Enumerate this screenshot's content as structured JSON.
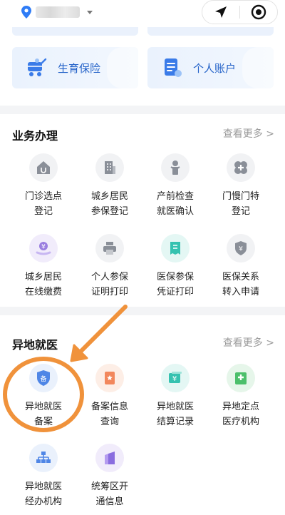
{
  "topbar": {
    "location_icon": "location-pin-icon",
    "capsule": {
      "nav_icon": "navigation-arrow-icon",
      "record_icon": "record-target-icon"
    }
  },
  "banner": {
    "cards": [
      {
        "label": "生育保险",
        "icon": "stroller-icon"
      },
      {
        "label": "个人账户",
        "icon": "account-document-icon"
      }
    ]
  },
  "business": {
    "title": "业务办理",
    "more": "查看更多 >",
    "items": [
      {
        "label": "门诊选点\n登记",
        "icon": "clinic-house-icon"
      },
      {
        "label": "城乡居民\n参保登记",
        "icon": "building-icon"
      },
      {
        "label": "产前检查\n就医确认",
        "icon": "baby-icon"
      },
      {
        "label": "门慢门特\n登记",
        "icon": "medical-cross-icon"
      },
      {
        "label": "城乡居民\n在线缴费",
        "icon": "yuan-hand-icon"
      },
      {
        "label": "个人参保\n证明打印",
        "icon": "printer-icon"
      },
      {
        "label": "医保参保\n凭证打印",
        "icon": "receipt-icon"
      },
      {
        "label": "医保关系\n转入申请",
        "icon": "shield-yuan-icon"
      }
    ]
  },
  "offsite": {
    "title": "异地就医",
    "more": "查看更多 >",
    "items": [
      {
        "label": "异地就医\n备案",
        "icon": "shield-record-icon",
        "badge": "备"
      },
      {
        "label": "备案信息\n查询",
        "icon": "certificate-icon"
      },
      {
        "label": "异地就医\n结算记录",
        "icon": "yuan-card-icon",
        "badge": "¥"
      },
      {
        "label": "异地定点\n医疗机构",
        "icon": "hospital-icon"
      },
      {
        "label": "异地就医\n经办机构",
        "icon": "org-chart-icon"
      },
      {
        "label": "统筹区开\n通信息",
        "icon": "book-icon"
      }
    ]
  },
  "colors": {
    "brand": "#2563c9",
    "annotation": "#f0923b"
  }
}
